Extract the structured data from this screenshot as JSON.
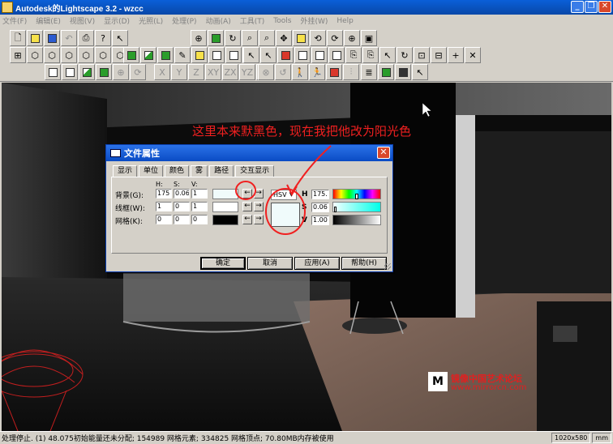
{
  "window": {
    "title": "Autodesk的Lightscape 3.2  - wzcc",
    "btn_min": "_",
    "btn_max": "❐",
    "btn_close": "✕"
  },
  "menu": [
    "文件(F)",
    "编辑(E)",
    "视图(V)",
    "显示(D)",
    "光照(L)",
    "处理(P)",
    "动画(A)",
    "工具(T)",
    "Tools",
    "外挂(W)",
    "Help"
  ],
  "toolbar": {
    "axis_labels": [
      "X",
      "Y",
      "Z",
      "XY",
      "ZX",
      "YZ",
      "H"
    ]
  },
  "annotation": {
    "text": "这里本来默黑色，现在我把他改为阳光色"
  },
  "dialog": {
    "title": "文件属性",
    "close_label": "✕",
    "tabs": [
      "显示",
      "单位",
      "颜色",
      "雾",
      "路径",
      "交互显示"
    ],
    "column_headers": {
      "h": "H:",
      "s": "S:",
      "v": "V:"
    },
    "rows": [
      {
        "label": "背景(G):",
        "h": "175",
        "s": "0.06",
        "v": "1",
        "swatch": "#f0fbfb"
      },
      {
        "label": "线框(W):",
        "h": "1",
        "s": "0",
        "v": "1",
        "swatch": "#ffffff"
      },
      {
        "label": "网格(K):",
        "h": "0",
        "s": "0",
        "v": "0",
        "swatch": "#000000"
      }
    ],
    "color_model": "HSV",
    "picker_labels": {
      "h": "H",
      "s": "S",
      "v": "V"
    },
    "picker_values": {
      "h": "175.",
      "s": "0.06",
      "v": "1.00"
    },
    "buttons": {
      "ok": "确定",
      "cancel": "取消",
      "apply": "应用(A)",
      "help": "帮助(H)"
    }
  },
  "watermark": {
    "logo": "M",
    "name": "镜像中国艺术论坛",
    "url": "www.mirrorcn.com"
  },
  "status": {
    "text": "处理停止. (1) 48.075初始能量还未分配; 154989 网格元素; 334825 网格顶点; 70.80MB内存被使用",
    "resolution": "1020x580",
    "unit": "mm"
  }
}
